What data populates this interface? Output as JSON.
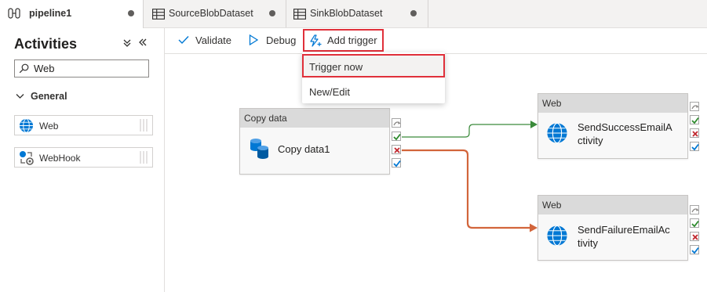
{
  "tabs": [
    {
      "label": "pipeline1",
      "icon": "pipeline-icon",
      "active": true
    },
    {
      "label": "SourceBlobDataset",
      "icon": "table-icon",
      "active": false
    },
    {
      "label": "SinkBlobDataset",
      "icon": "table-icon",
      "active": false
    }
  ],
  "activities": {
    "title": "Activities",
    "search_value": "Web",
    "group_label": "General",
    "items": [
      {
        "label": "Web",
        "icon": "globe-icon"
      },
      {
        "label": "WebHook",
        "icon": "webhook-icon"
      }
    ]
  },
  "toolbar": {
    "validate_label": "Validate",
    "debug_label": "Debug",
    "add_trigger_label": "Add trigger"
  },
  "trigger_menu": {
    "items": [
      {
        "label": "Trigger now",
        "highlighted": true
      },
      {
        "label": "New/Edit",
        "highlighted": false
      }
    ]
  },
  "nodes": {
    "copy": {
      "type_label": "Copy data",
      "name": "Copy data1",
      "icon": "copy-data-icon"
    },
    "success": {
      "type_label": "Web",
      "name_line1": "SendSuccessEmailA",
      "name_line2": "ctivity",
      "icon": "globe-icon"
    },
    "failure": {
      "type_label": "Web",
      "name_line1": "SendFailureEmailAc",
      "name_line2": "tivity",
      "icon": "globe-icon"
    }
  },
  "colors": {
    "highlight_red": "#e0303a",
    "success_green": "#3a8a3a",
    "failure_orange": "#d2653b",
    "azure_blue": "#0078d4"
  }
}
